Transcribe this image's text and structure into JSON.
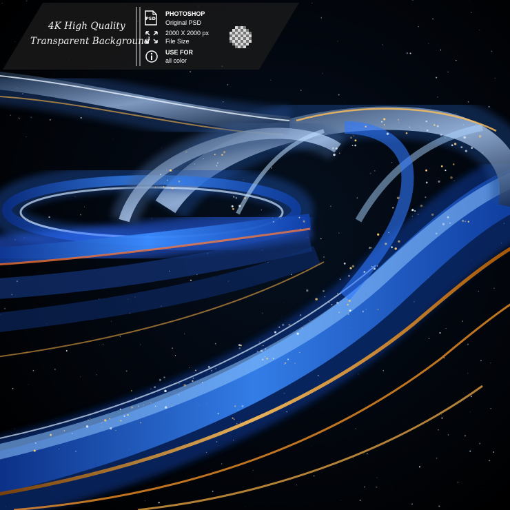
{
  "banner": {
    "quality_title": "4K High Quality",
    "background_title": "Transparent Background",
    "photoshop_label": "PHOTOSHOP",
    "photoshop_sub": "Original PSD",
    "psd_badge": "PSD",
    "size_label": "2000 X 2000 px",
    "size_sub": "File Size",
    "color_label": "USE FOR",
    "color_sub": "all color",
    "icons": [
      "psd-file-icon",
      "resize-arrows-icon",
      "info-icon",
      "transparency-checker-icon"
    ]
  },
  "scene": {
    "subject": "",
    "colors": {
      "background": "#000000",
      "blue": "#2f78ff",
      "cyan": "#9fd8ff",
      "gold": "#ffb34a",
      "white": "#ffffff"
    }
  }
}
